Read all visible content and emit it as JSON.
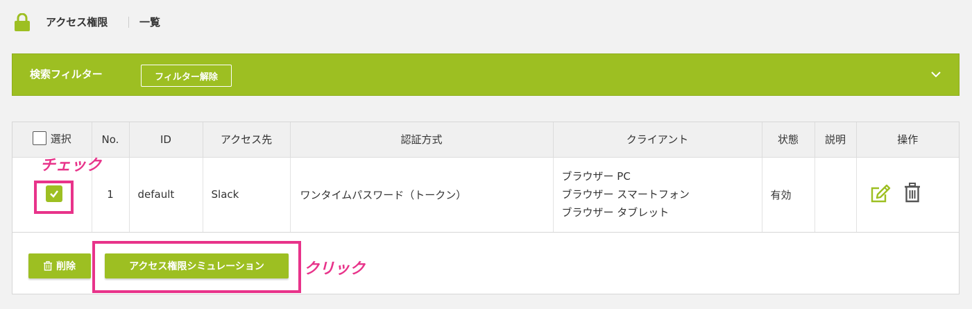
{
  "header": {
    "title": "アクセス権限",
    "subtitle": "一覧"
  },
  "filter": {
    "label": "検索フィルター",
    "clear_button": "フィルター解除"
  },
  "table": {
    "columns": {
      "select": "選択",
      "no": "No.",
      "id": "ID",
      "target": "アクセス先",
      "auth": "認証方式",
      "client": "クライアント",
      "status": "状態",
      "description": "説明",
      "actions": "操作"
    },
    "rows": [
      {
        "no": "1",
        "id": "default",
        "target": "Slack",
        "auth": "ワンタイムパスワード（トークン）",
        "clients": [
          "ブラウザー PC",
          "ブラウザー スマートフォン",
          "ブラウザー タブレット"
        ],
        "status": "有効",
        "description": "",
        "checked": true
      }
    ]
  },
  "buttons": {
    "delete": "削除",
    "simulation": "アクセス権限シミュレーション"
  },
  "annotations": {
    "check": "チェック",
    "click": "クリック"
  },
  "colors": {
    "accent": "#9dbf22",
    "highlight": "#e8338a"
  }
}
